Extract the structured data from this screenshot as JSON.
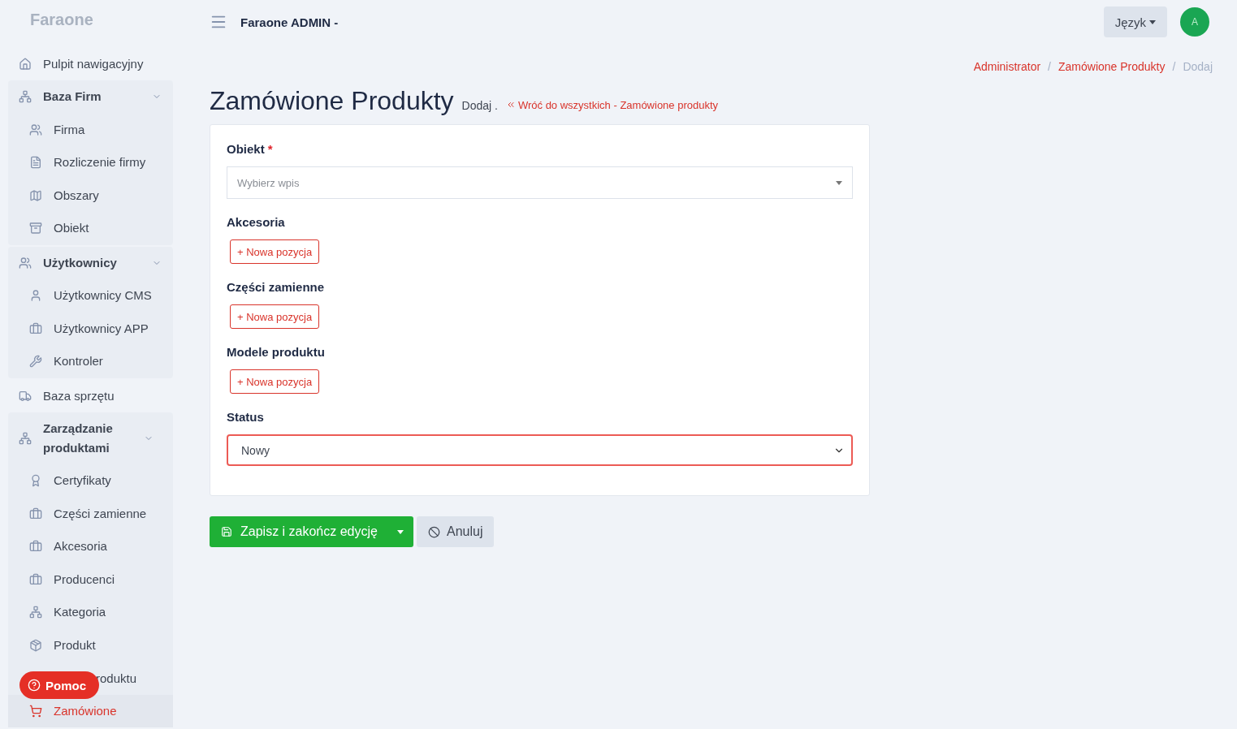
{
  "brand": "Faraone",
  "topbar": {
    "title": "Faraone ADMIN -",
    "language_button": "Język",
    "avatar": "A"
  },
  "sidebar": {
    "items": [
      {
        "kind": "link",
        "label": "Pulpit nawigacyjny",
        "selected": false
      },
      {
        "kind": "group",
        "label": "Baza Firm",
        "expanded": true,
        "children": [
          {
            "label": "Firma",
            "selected": false
          },
          {
            "label": "Rozliczenie firmy",
            "selected": false
          },
          {
            "label": "Obszary",
            "selected": false
          },
          {
            "label": "Obiekt",
            "selected": false
          }
        ]
      },
      {
        "kind": "group",
        "label": "Użytkownicy",
        "expanded": true,
        "children": [
          {
            "label": "Użytkownicy CMS",
            "selected": false
          },
          {
            "label": "Użytkownicy APP",
            "selected": false
          },
          {
            "label": "Kontroler",
            "selected": false
          }
        ]
      },
      {
        "kind": "link",
        "label": "Baza sprzętu",
        "selected": false
      },
      {
        "kind": "group",
        "label": "Zarządzanie produktami",
        "expanded": true,
        "children": [
          {
            "label": "Certyfikaty",
            "selected": false
          },
          {
            "label": "Części zamienne",
            "selected": false
          },
          {
            "label": "Akcesoria",
            "selected": false
          },
          {
            "label": "Producenci",
            "selected": false
          },
          {
            "label": "Kategoria",
            "selected": false
          },
          {
            "label": "Produkt",
            "selected": false
          },
          {
            "label": "roduktu",
            "covered": true
          },
          {
            "label": "Zamówione",
            "selected": true
          }
        ]
      }
    ]
  },
  "help_button": "Pomoc",
  "breadcrumb": [
    {
      "label": "Administrator",
      "link": true
    },
    {
      "label": "/",
      "separator": true
    },
    {
      "label": "Zamówione Produkty",
      "link": true
    },
    {
      "label": "/",
      "separator": true
    },
    {
      "label": "Dodaj",
      "link": false
    }
  ],
  "page": {
    "title": "Zamówione Produkty",
    "subtitle": "Dodaj .",
    "back_link": "Wróć do wszystkich - Zamówione produkty"
  },
  "form": {
    "fields": [
      {
        "kind": "select2",
        "label": "Obiekt",
        "required_mark": "*",
        "placeholder": "Wybierz wpis"
      },
      {
        "kind": "repeater",
        "label": "Akcesoria",
        "button": "+ Nowa pozycja"
      },
      {
        "kind": "repeater",
        "label": "Części zamienne",
        "button": "+ Nowa pozycja"
      },
      {
        "kind": "repeater",
        "label": "Modele produktu",
        "button": "+ Nowa pozycja"
      },
      {
        "kind": "select",
        "label": "Status",
        "value": "Nowy",
        "invalid": true
      }
    ]
  },
  "actions": {
    "save": "Zapisz i zakończ edycję",
    "cancel": "Anuluj"
  }
}
